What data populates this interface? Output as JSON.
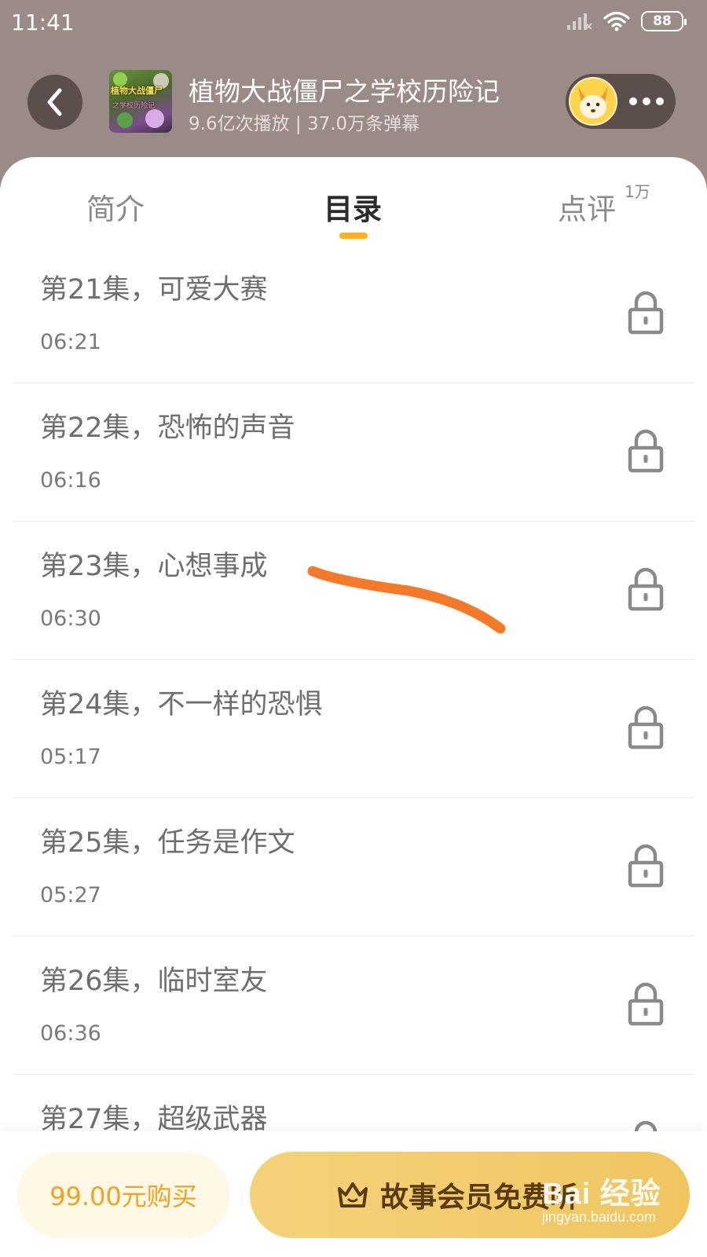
{
  "status_bar": {
    "time": "11:41",
    "battery": "88",
    "icons": [
      "signal-icon",
      "wifi-icon",
      "battery-icon"
    ]
  },
  "header": {
    "title": "植物大战僵尸之学校历险记",
    "stats": "9.6亿次播放 | 37.0万条弹幕",
    "cover_title": "植物大战僵尸",
    "cover_sub": "之学校历险记"
  },
  "tabs": [
    {
      "label": "简介"
    },
    {
      "label": "目录"
    },
    {
      "label": "点评",
      "badge": "1万"
    }
  ],
  "episodes": [
    {
      "title": "第21集，可爱大赛",
      "duration": "06:21"
    },
    {
      "title": "第22集，恐怖的声音",
      "duration": "06:16"
    },
    {
      "title": "第23集，心想事成",
      "duration": "06:30"
    },
    {
      "title": "第24集，不一样的恐惧",
      "duration": "05:17"
    },
    {
      "title": "第25集，任务是作文",
      "duration": "05:27"
    },
    {
      "title": "第26集，临时室友",
      "duration": "06:36"
    },
    {
      "title": "第27集，超级武器",
      "duration": ""
    }
  ],
  "bottom_bar": {
    "buy_label": "99.00元购买",
    "member_label": "故事会员免费听"
  },
  "watermark": {
    "main": "Bai 经验",
    "sub": "jingyan.baidu.com"
  },
  "colors": {
    "header_bg": "#9a8b87",
    "accent": "#ffb11b",
    "member_button": "#f2c966",
    "annotation_stroke": "#f47a2a"
  }
}
